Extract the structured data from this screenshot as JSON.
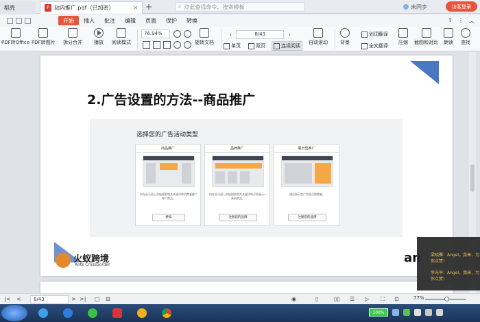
{
  "titlebar": {
    "prev_tab_label": "稻壳",
    "doc_tab_label": "站内推广.pdf（已加密）",
    "search_placeholder": "点此查找命令、搜索模板",
    "sync_label": "未同步",
    "login_label": "访客登录"
  },
  "menubar": {
    "items": [
      "开始",
      "插入",
      "批注",
      "编辑",
      "页面",
      "保护",
      "转换"
    ],
    "active_index": 0,
    "right_items": [
      "分享"
    ]
  },
  "toolbar": {
    "pdf_to_office": "PDF转Office",
    "pdf_to_image": "PDF转图片",
    "split_merge": "拆分合并",
    "play": "播放",
    "read_mode": "阅读模式",
    "zoom_value": "76.94%",
    "rotate_doc": "旋转文档",
    "page_value": "8/43",
    "single_page": "单页",
    "double_page": "双页",
    "continuous_read": "连续阅读",
    "auto_scroll": "自动滚动",
    "background": "背景",
    "word_translate": "划词翻译",
    "full_translate": "全文翻译",
    "compress": "压缩",
    "screenshot_compare": "截图和对比",
    "read_aloud": "朗读",
    "search": "查找"
  },
  "slide": {
    "title": "2.广告设置的方法--商品推广",
    "shot_title": "选择您的广告活动类型",
    "cards": [
      {
        "title": "商品推广",
        "desc": "向在亚马逊上积极搜索相关关键词的消费者推广单个商品。",
        "button": "继续"
      },
      {
        "title": "品牌推广",
        "desc": "向在亚马逊上积极搜索相关关键词的买家展示一系列商品。",
        "button": "注册您的品牌"
      },
      {
        "title": "展示型推广",
        "desc": "通过展示型广告吸引购物者。",
        "button": "注册您的品牌"
      }
    ],
    "logo_text": "火蚁跨境",
    "logo_sub": "Ants Crossborder",
    "ants_mark": "an"
  },
  "chat": {
    "lines": [
      "梁晓雅：Angel，我来，为你点赞！",
      "李光平：Angel，我来，为你点赞！"
    ]
  },
  "statusbar": {
    "page_value": "8/43",
    "zoom_value": "77%"
  },
  "taskbar": {
    "battery_label": "100%"
  },
  "colors": {
    "accent": "#e8553d",
    "slide_blue": "#4a78c2",
    "taskbar": "#1b3457"
  }
}
